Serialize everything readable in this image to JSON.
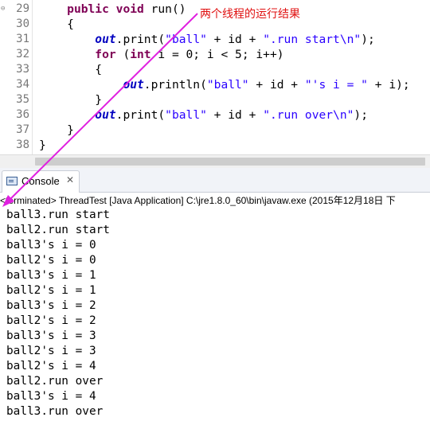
{
  "editor": {
    "lines": [
      {
        "num": "29",
        "fold": "⊖",
        "tokens": [
          {
            "t": "    "
          },
          {
            "t": "public",
            "c": "kw"
          },
          {
            "t": " "
          },
          {
            "t": "void",
            "c": "kw"
          },
          {
            "t": " run()"
          }
        ]
      },
      {
        "num": "30",
        "tokens": [
          {
            "t": "    {"
          }
        ]
      },
      {
        "num": "31",
        "tokens": [
          {
            "t": "        "
          },
          {
            "t": "out",
            "c": "fld"
          },
          {
            "t": ".print("
          },
          {
            "t": "\"ball\"",
            "c": "str"
          },
          {
            "t": " + id + "
          },
          {
            "t": "\".run start\\n\"",
            "c": "str"
          },
          {
            "t": ");"
          }
        ]
      },
      {
        "num": "32",
        "tokens": [
          {
            "t": "        "
          },
          {
            "t": "for",
            "c": "kw"
          },
          {
            "t": " ("
          },
          {
            "t": "int",
            "c": "kw"
          },
          {
            "t": " i = 0; i < 5; i++)"
          }
        ]
      },
      {
        "num": "33",
        "tokens": [
          {
            "t": "        {"
          }
        ]
      },
      {
        "num": "34",
        "tokens": [
          {
            "t": "            "
          },
          {
            "t": "out",
            "c": "fld"
          },
          {
            "t": ".println("
          },
          {
            "t": "\"ball\"",
            "c": "str"
          },
          {
            "t": " + id + "
          },
          {
            "t": "\"'s i = \"",
            "c": "str"
          },
          {
            "t": " + i);"
          }
        ]
      },
      {
        "num": "35",
        "tokens": [
          {
            "t": "        }"
          }
        ]
      },
      {
        "num": "36",
        "tokens": [
          {
            "t": "        "
          },
          {
            "t": "out",
            "c": "fld"
          },
          {
            "t": ".print("
          },
          {
            "t": "\"ball\"",
            "c": "str"
          },
          {
            "t": " + id + "
          },
          {
            "t": "\".run over\\n\"",
            "c": "str"
          },
          {
            "t": ");"
          }
        ]
      },
      {
        "num": "37",
        "tokens": [
          {
            "t": "    }"
          }
        ]
      },
      {
        "num": "38",
        "tokens": [
          {
            "t": "}"
          }
        ]
      }
    ]
  },
  "annotation": {
    "text": "两个线程的运行结果",
    "color": "#e01010",
    "arrow_color": "#e020e0"
  },
  "console": {
    "tab_label": "Console",
    "tab_close": "✕",
    "status": "<terminated> ThreadTest [Java Application] C:\\jre1.8.0_60\\bin\\javaw.exe (2015年12月18日 下",
    "output": [
      "ball3.run start",
      "ball2.run start",
      "ball3's i = 0",
      "ball2's i = 0",
      "ball3's i = 1",
      "ball2's i = 1",
      "ball3's i = 2",
      "ball2's i = 2",
      "ball3's i = 3",
      "ball2's i = 3",
      "ball2's i = 4",
      "ball2.run over",
      "ball3's i = 4",
      "ball3.run over"
    ]
  },
  "colors": {
    "keyword": "#7f0055",
    "field": "#0000c0",
    "string": "#2a00ff",
    "line_number": "#787878"
  },
  "icons": {
    "console": "console-icon",
    "close": "close-icon",
    "fold": "fold-icon"
  }
}
